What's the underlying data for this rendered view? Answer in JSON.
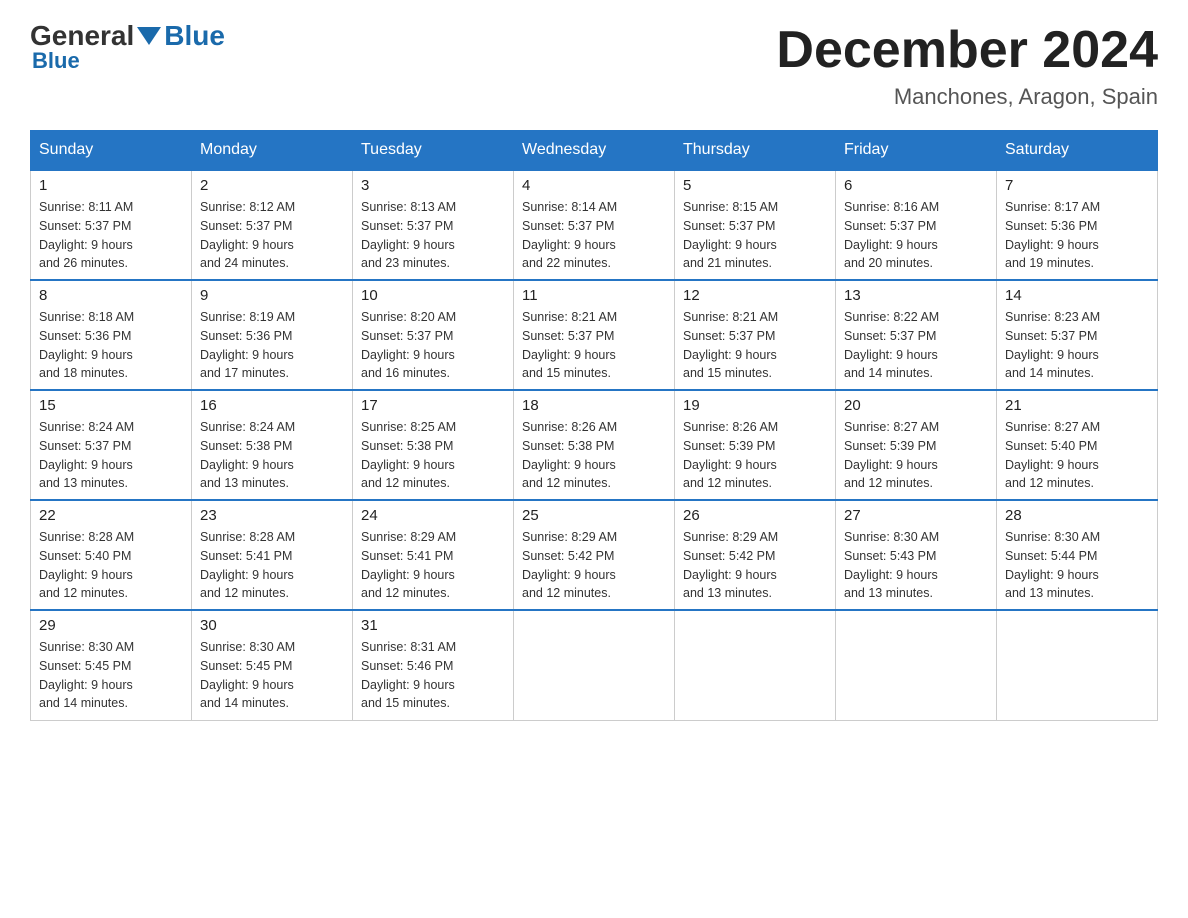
{
  "header": {
    "logo_general": "General",
    "logo_blue": "Blue",
    "month_title": "December 2024",
    "location": "Manchones, Aragon, Spain"
  },
  "days_of_week": [
    "Sunday",
    "Monday",
    "Tuesday",
    "Wednesday",
    "Thursday",
    "Friday",
    "Saturday"
  ],
  "weeks": [
    [
      {
        "day": "1",
        "sunrise": "8:11 AM",
        "sunset": "5:37 PM",
        "daylight": "9 hours and 26 minutes."
      },
      {
        "day": "2",
        "sunrise": "8:12 AM",
        "sunset": "5:37 PM",
        "daylight": "9 hours and 24 minutes."
      },
      {
        "day": "3",
        "sunrise": "8:13 AM",
        "sunset": "5:37 PM",
        "daylight": "9 hours and 23 minutes."
      },
      {
        "day": "4",
        "sunrise": "8:14 AM",
        "sunset": "5:37 PM",
        "daylight": "9 hours and 22 minutes."
      },
      {
        "day": "5",
        "sunrise": "8:15 AM",
        "sunset": "5:37 PM",
        "daylight": "9 hours and 21 minutes."
      },
      {
        "day": "6",
        "sunrise": "8:16 AM",
        "sunset": "5:37 PM",
        "daylight": "9 hours and 20 minutes."
      },
      {
        "day": "7",
        "sunrise": "8:17 AM",
        "sunset": "5:36 PM",
        "daylight": "9 hours and 19 minutes."
      }
    ],
    [
      {
        "day": "8",
        "sunrise": "8:18 AM",
        "sunset": "5:36 PM",
        "daylight": "9 hours and 18 minutes."
      },
      {
        "day": "9",
        "sunrise": "8:19 AM",
        "sunset": "5:36 PM",
        "daylight": "9 hours and 17 minutes."
      },
      {
        "day": "10",
        "sunrise": "8:20 AM",
        "sunset": "5:37 PM",
        "daylight": "9 hours and 16 minutes."
      },
      {
        "day": "11",
        "sunrise": "8:21 AM",
        "sunset": "5:37 PM",
        "daylight": "9 hours and 15 minutes."
      },
      {
        "day": "12",
        "sunrise": "8:21 AM",
        "sunset": "5:37 PM",
        "daylight": "9 hours and 15 minutes."
      },
      {
        "day": "13",
        "sunrise": "8:22 AM",
        "sunset": "5:37 PM",
        "daylight": "9 hours and 14 minutes."
      },
      {
        "day": "14",
        "sunrise": "8:23 AM",
        "sunset": "5:37 PM",
        "daylight": "9 hours and 14 minutes."
      }
    ],
    [
      {
        "day": "15",
        "sunrise": "8:24 AM",
        "sunset": "5:37 PM",
        "daylight": "9 hours and 13 minutes."
      },
      {
        "day": "16",
        "sunrise": "8:24 AM",
        "sunset": "5:38 PM",
        "daylight": "9 hours and 13 minutes."
      },
      {
        "day": "17",
        "sunrise": "8:25 AM",
        "sunset": "5:38 PM",
        "daylight": "9 hours and 12 minutes."
      },
      {
        "day": "18",
        "sunrise": "8:26 AM",
        "sunset": "5:38 PM",
        "daylight": "9 hours and 12 minutes."
      },
      {
        "day": "19",
        "sunrise": "8:26 AM",
        "sunset": "5:39 PM",
        "daylight": "9 hours and 12 minutes."
      },
      {
        "day": "20",
        "sunrise": "8:27 AM",
        "sunset": "5:39 PM",
        "daylight": "9 hours and 12 minutes."
      },
      {
        "day": "21",
        "sunrise": "8:27 AM",
        "sunset": "5:40 PM",
        "daylight": "9 hours and 12 minutes."
      }
    ],
    [
      {
        "day": "22",
        "sunrise": "8:28 AM",
        "sunset": "5:40 PM",
        "daylight": "9 hours and 12 minutes."
      },
      {
        "day": "23",
        "sunrise": "8:28 AM",
        "sunset": "5:41 PM",
        "daylight": "9 hours and 12 minutes."
      },
      {
        "day": "24",
        "sunrise": "8:29 AM",
        "sunset": "5:41 PM",
        "daylight": "9 hours and 12 minutes."
      },
      {
        "day": "25",
        "sunrise": "8:29 AM",
        "sunset": "5:42 PM",
        "daylight": "9 hours and 12 minutes."
      },
      {
        "day": "26",
        "sunrise": "8:29 AM",
        "sunset": "5:42 PM",
        "daylight": "9 hours and 13 minutes."
      },
      {
        "day": "27",
        "sunrise": "8:30 AM",
        "sunset": "5:43 PM",
        "daylight": "9 hours and 13 minutes."
      },
      {
        "day": "28",
        "sunrise": "8:30 AM",
        "sunset": "5:44 PM",
        "daylight": "9 hours and 13 minutes."
      }
    ],
    [
      {
        "day": "29",
        "sunrise": "8:30 AM",
        "sunset": "5:45 PM",
        "daylight": "9 hours and 14 minutes."
      },
      {
        "day": "30",
        "sunrise": "8:30 AM",
        "sunset": "5:45 PM",
        "daylight": "9 hours and 14 minutes."
      },
      {
        "day": "31",
        "sunrise": "8:31 AM",
        "sunset": "5:46 PM",
        "daylight": "9 hours and 15 minutes."
      },
      {
        "day": "",
        "sunrise": "",
        "sunset": "",
        "daylight": ""
      },
      {
        "day": "",
        "sunrise": "",
        "sunset": "",
        "daylight": ""
      },
      {
        "day": "",
        "sunrise": "",
        "sunset": "",
        "daylight": ""
      },
      {
        "day": "",
        "sunrise": "",
        "sunset": "",
        "daylight": ""
      }
    ]
  ],
  "labels": {
    "sunrise": "Sunrise:",
    "sunset": "Sunset:",
    "daylight": "Daylight:"
  }
}
